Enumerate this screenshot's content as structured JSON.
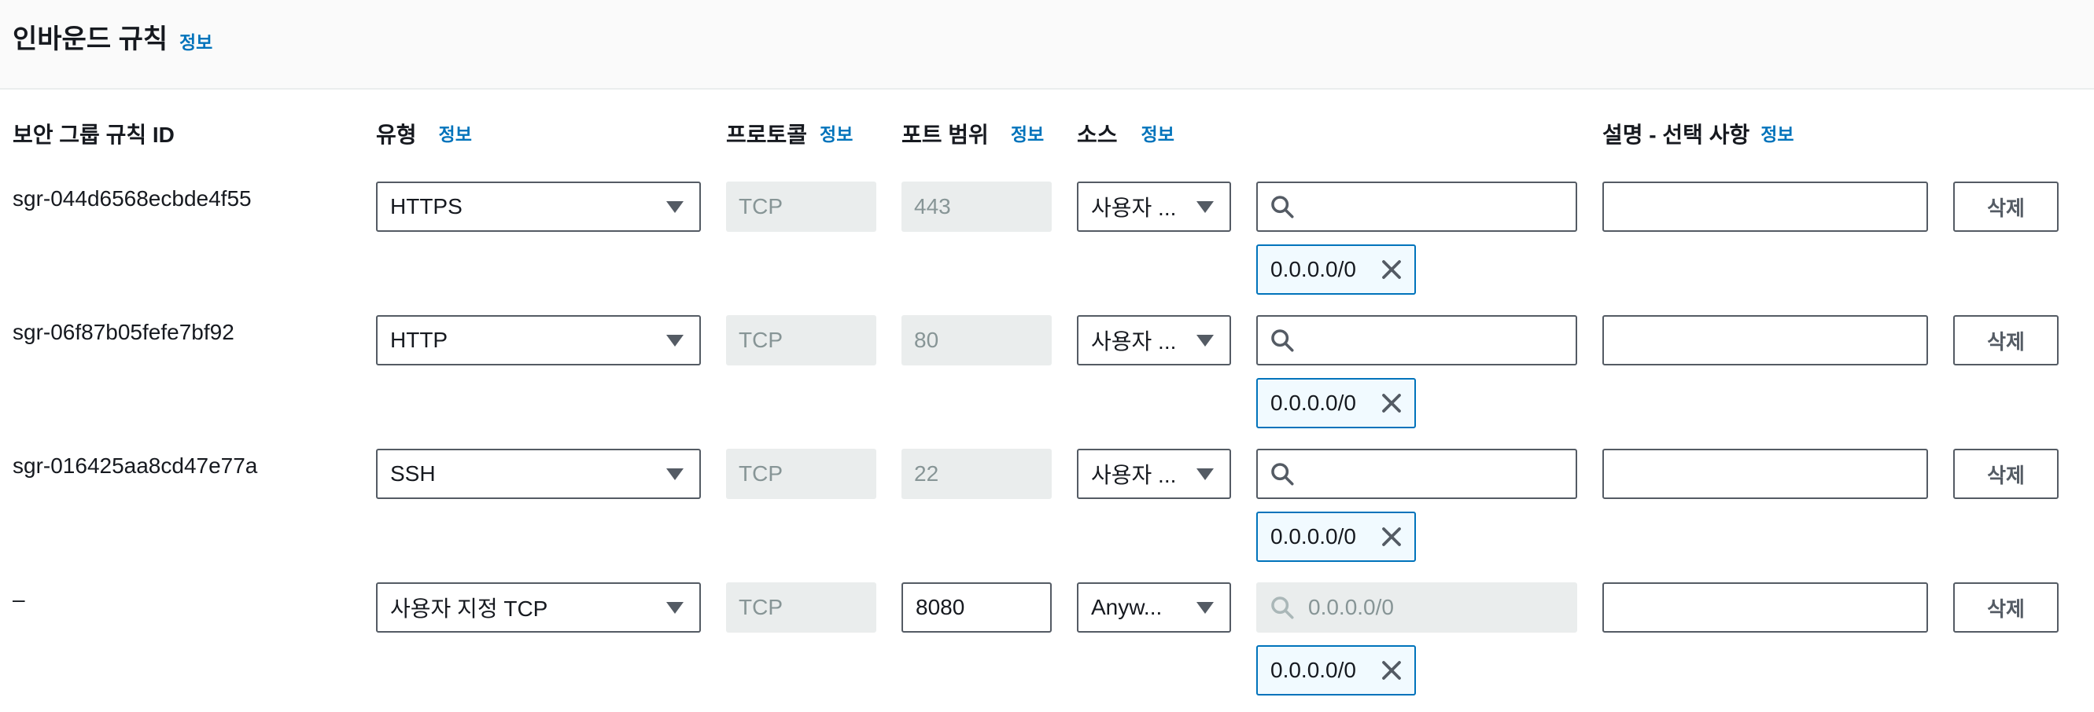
{
  "header": {
    "title": "인바운드 규칙",
    "info": "정보"
  },
  "columns": {
    "rule_id": "보안 그룹 규칙 ID",
    "type": "유형",
    "protocol": "프로토콜",
    "port_range": "포트 범위",
    "source": "소스",
    "description": "설명 - 선택 사항",
    "info": "정보"
  },
  "rules": [
    {
      "id": "sgr-044d6568ecbde4f55",
      "type": "HTTPS",
      "protocol": "TCP",
      "port": "443",
      "source": "사용자 ...",
      "search_placeholder": "",
      "cidr": "0.0.0.0/0",
      "description": "",
      "delete": "삭제"
    },
    {
      "id": "sgr-06f87b05fefe7bf92",
      "type": "HTTP",
      "protocol": "TCP",
      "port": "80",
      "source": "사용자 ...",
      "search_placeholder": "",
      "cidr": "0.0.0.0/0",
      "description": "",
      "delete": "삭제"
    },
    {
      "id": "sgr-016425aa8cd47e77a",
      "type": "SSH",
      "protocol": "TCP",
      "port": "22",
      "source": "사용자 ...",
      "search_placeholder": "",
      "cidr": "0.0.0.0/0",
      "description": "",
      "delete": "삭제"
    },
    {
      "id": "–",
      "type": "사용자 지정 TCP",
      "protocol": "TCP",
      "port": "8080",
      "source": "Anyw...",
      "search_placeholder": "0.0.0.0/0",
      "cidr": "0.0.0.0/0",
      "description": "",
      "delete": "삭제"
    }
  ],
  "colors": {
    "link": "#0073bb",
    "border": "#545b64",
    "disabled_bg": "#eaeded",
    "token_bg": "#f1faff"
  }
}
